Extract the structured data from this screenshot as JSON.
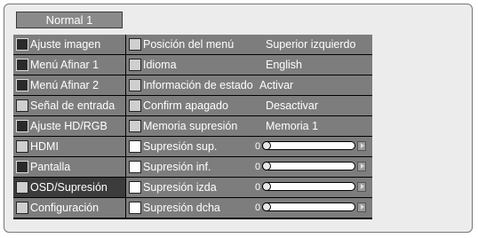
{
  "header": {
    "tab_label": "Normal 1"
  },
  "sidebar": {
    "items": [
      {
        "label": "Ajuste imagen",
        "icon": "picture-adjust-icon"
      },
      {
        "label": "Menú Afinar 1",
        "icon": "fine-tune-icon"
      },
      {
        "label": "Menú Afinar 2",
        "icon": "fine-tune-icon"
      },
      {
        "label": "Señal de entrada",
        "icon": "input-signal-icon"
      },
      {
        "label": "Ajuste HD/RGB",
        "icon": "monitor-icon"
      },
      {
        "label": "HDMI",
        "icon": "hdmi-icon"
      },
      {
        "label": "Pantalla",
        "icon": "screen-icon"
      },
      {
        "label": "OSD/Supresión",
        "icon": "osd-icon",
        "selected": true
      },
      {
        "label": "Configuración",
        "icon": "settings-icon"
      }
    ]
  },
  "main": {
    "rows": [
      {
        "label": "Posición del menú",
        "value": "Superior izquierdo",
        "icon": "menu-position-icon"
      },
      {
        "label": "Idioma",
        "value": "English",
        "icon": "globe-icon"
      },
      {
        "label": "Información de estado",
        "value": "Activar",
        "icon": "status-info-icon"
      },
      {
        "label": "Confirm apagado",
        "value": "Desactivar",
        "icon": "power-icon"
      },
      {
        "label": "Memoria supresión",
        "value": "Memoria 1",
        "icon": "blanking-memory-icon"
      },
      {
        "label": "Supresión sup.",
        "value": "0",
        "icon": "blank-top-icon",
        "slider_level": 0
      },
      {
        "label": "Supresión inf.",
        "value": "0",
        "icon": "blank-bottom-icon",
        "slider_level": 0
      },
      {
        "label": "Supresión izda",
        "value": "0",
        "icon": "blank-left-icon",
        "slider_level": 0
      },
      {
        "label": "Supresión dcha",
        "value": "0",
        "icon": "blank-right-icon",
        "slider_level": 0
      }
    ]
  }
}
